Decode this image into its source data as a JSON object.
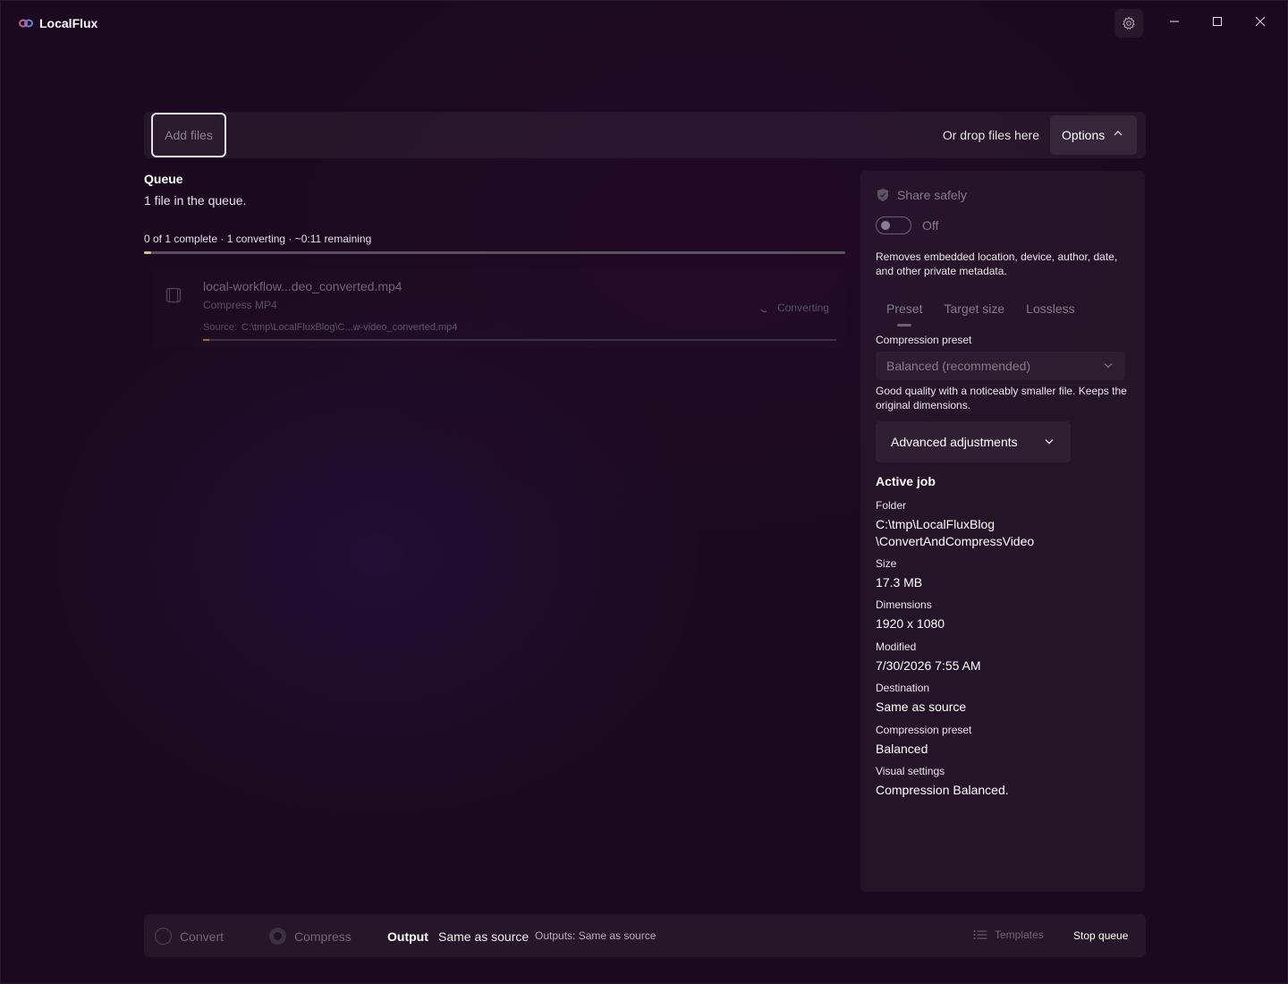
{
  "app": {
    "title": "LocalFlux"
  },
  "topbar": {
    "add_files_label": "Add files",
    "drop_hint": "Or drop files here",
    "options_label": "Options"
  },
  "queue": {
    "title": "Queue",
    "count_text": "1 file in the queue.",
    "summary": "0 of 1 complete · 1 converting · ~0:11 remaining",
    "progress_fraction": 0.01,
    "jobs": [
      {
        "name": "local-workflow...deo_converted.mp4",
        "operation": "Compress MP4",
        "status": "Converting",
        "source_label": "Source:",
        "source_path": "C:\\tmp\\LocalFluxBlog\\C...w-video_converted.mp4",
        "progress_fraction": 0.01
      }
    ]
  },
  "panel": {
    "share": {
      "title": "Share safely",
      "toggle_state": "Off",
      "description": "Removes embedded location, device, author, date, and other private metadata."
    },
    "tabs": [
      "Preset",
      "Target size",
      "Lossless"
    ],
    "active_tab": "Preset",
    "compression_preset_label": "Compression preset",
    "compression_preset_value": "Balanced (recommended)",
    "preset_description": "Good quality with a noticeably smaller file. Keeps the original dimensions.",
    "advanced_label": "Advanced adjustments",
    "active_job": {
      "title": "Active job",
      "fields": [
        {
          "label": "Folder",
          "value": "C:\\tmp\\LocalFluxBlog\n\\ConvertAndCompressVideo"
        },
        {
          "label": "Size",
          "value": "17.3 MB"
        },
        {
          "label": "Dimensions",
          "value": "1920 x 1080"
        },
        {
          "label": "Modified",
          "value": "7/30/2026 7:55 AM"
        },
        {
          "label": "Destination",
          "value": "Same as source"
        },
        {
          "label": "Compression preset",
          "value": "Balanced"
        },
        {
          "label": "Visual settings",
          "value": "Compression Balanced."
        }
      ]
    }
  },
  "bottombar": {
    "mode_convert": "Convert",
    "mode_compress": "Compress",
    "selected_mode": "Compress",
    "output_label": "Output",
    "output_value": "Same as source",
    "outputs_note": "Outputs: Same as source",
    "templates_label": "Templates",
    "stop_queue_label": "Stop queue"
  },
  "icons": {
    "logo": "infinity-logo-icon",
    "settings": "gear-icon",
    "minimize": "minimize-icon",
    "maximize": "maximize-icon",
    "close": "close-icon",
    "shield": "shield-icon",
    "film": "film-icon",
    "spinner": "spinner-icon",
    "list": "list-icon"
  }
}
